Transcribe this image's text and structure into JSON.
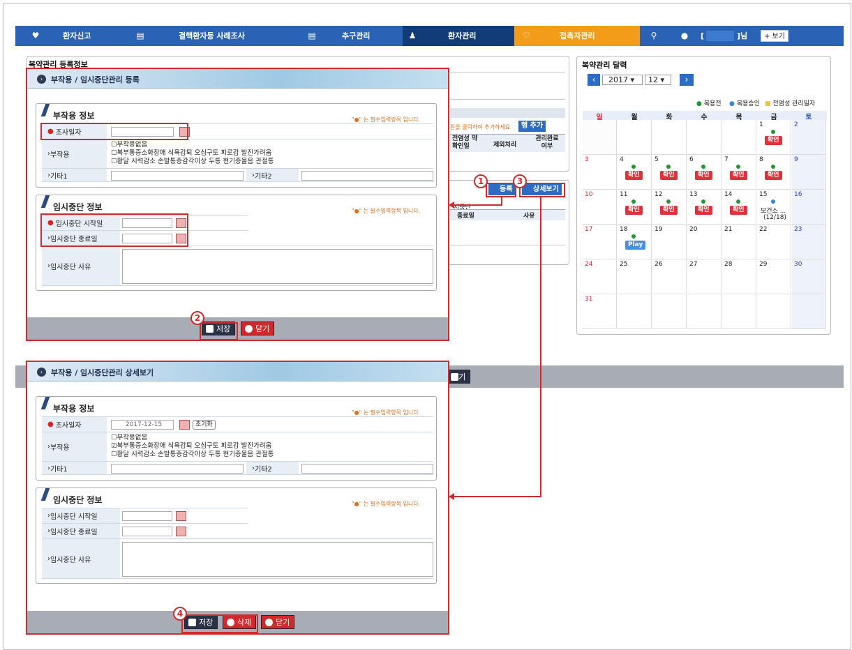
{
  "nav": {
    "items": [
      "환자신고",
      "결핵환자등 사례조사",
      "추구관리",
      "환자관리",
      "접촉자관리"
    ],
    "user_bracket_left": "[",
    "user_bracket_right": "]님",
    "more": "+ 보기"
  },
  "bg_panel": {
    "title": "복약관리 등록정보",
    "hint": "튼을 클릭하여 추가하세요",
    "row_add": "행 추가",
    "col1": "전염성 약확인일",
    "col2": "제외처리",
    "col3": "관리완료 여부",
    "sub_label": "시중단",
    "col_end": "종료일",
    "col_reason": "사유",
    "btn_register": "등록",
    "btn_detail": "상세보기",
    "close": "닫기"
  },
  "calendar": {
    "title": "복약관리 달력",
    "year": "2017",
    "month": "12",
    "legend": [
      "복용전",
      "복용승인",
      "전염성 관리일자"
    ],
    "days": [
      "일",
      "월",
      "화",
      "수",
      "목",
      "금",
      "토"
    ],
    "dates": [
      "1",
      "2",
      "3",
      "4",
      "5",
      "6",
      "7",
      "8",
      "9",
      "10",
      "11",
      "12",
      "13",
      "14",
      "15",
      "16",
      "17",
      "18",
      "19",
      "20",
      "21",
      "22",
      "23",
      "24",
      "25",
      "26",
      "27",
      "28",
      "29",
      "30",
      "31"
    ],
    "confirm": "확인",
    "play": "Play",
    "health_center": "보건소 ...",
    "health_date": "(12/18)"
  },
  "modal1": {
    "title": "부작용 / 임시중단관리 등록"
  },
  "modal2": {
    "title": "부작용 / 임시중단관리 상세보기"
  },
  "form": {
    "sec1": "부작용 정보",
    "sec2": "임시중단 정보",
    "required_note": "\"●\" 는 필수입력항목 입니다.",
    "survey_date": "조사일자",
    "side_effect": "부작용",
    "etc1": "기타1",
    "etc2": "기타2",
    "cb_line1": "부작용없음",
    "cb_line2": "복부통증소화장애  식욕감퇴  오심구토  피로감  발진가려움",
    "cb_line3": "황달  시력감소  손발통증감각이상  두통  현기증울음  관절통",
    "stop_start": "임시중단 시작일",
    "stop_end": "임시중단 종료일",
    "stop_reason": "임시중단 사유",
    "date_value": "2017-12-15",
    "reset": "초기화"
  },
  "buttons": {
    "save": "저장",
    "close": "닫기",
    "delete": "삭제"
  },
  "steps": [
    "1",
    "2",
    "3",
    "4"
  ]
}
